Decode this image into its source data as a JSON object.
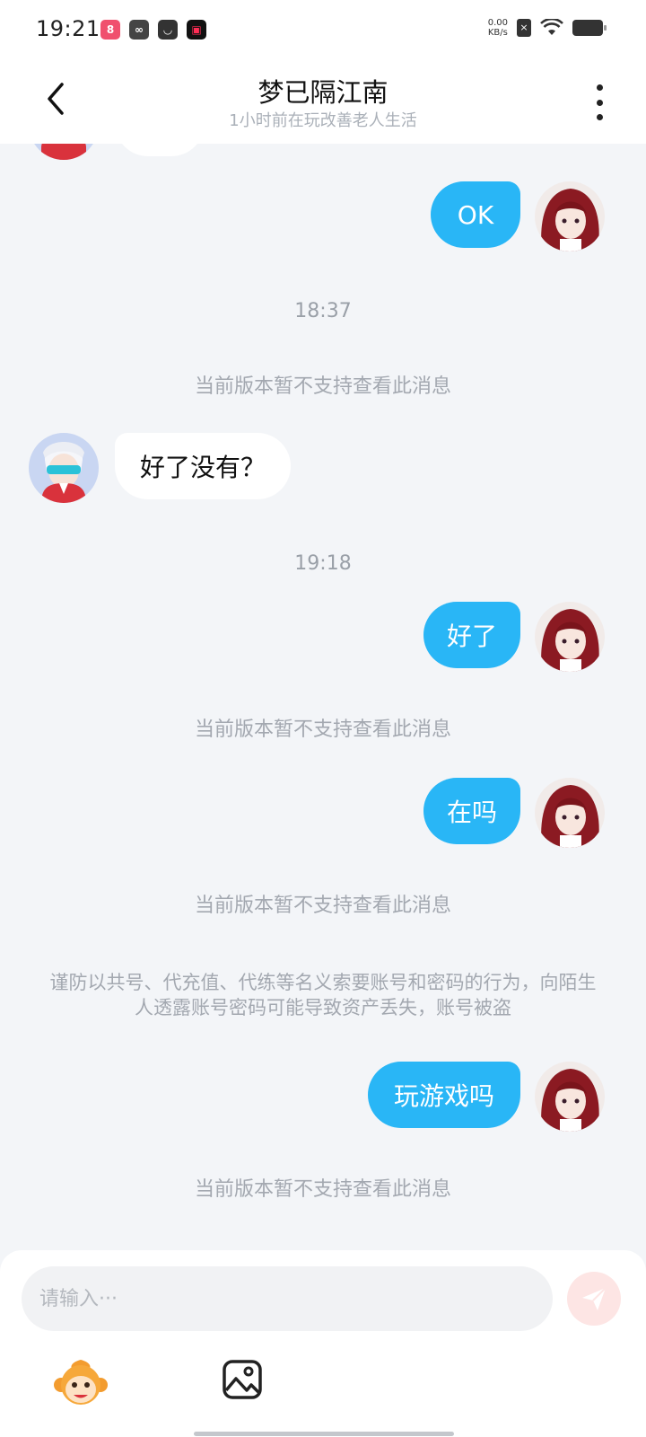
{
  "status_bar": {
    "time": "19:21",
    "net_speed_value": "0.00",
    "net_speed_unit": "KB/s"
  },
  "header": {
    "title": "梦已隔江南",
    "subtitle": "1小时前在玩改善老人生活"
  },
  "messages": {
    "m1": "OK",
    "t1": "18:37",
    "s1": "当前版本暂不支持查看此消息",
    "m2": "好了没有？",
    "t2": "19:18",
    "m3": "好了",
    "s2": "当前版本暂不支持查看此消息",
    "m4": "在吗",
    "s3": "当前版本暂不支持查看此消息",
    "warning": "谨防以共号、代充值、代练等名义索要账号和密码的行为，向陌生人透露账号密码可能导致资产丢失，账号被盗",
    "m5": "玩游戏吗",
    "s4": "当前版本暂不支持查看此消息"
  },
  "input": {
    "placeholder": "请输入···"
  },
  "icons": {
    "back": "chevron-left-icon",
    "more": "more-vertical-icon",
    "send": "send-icon",
    "emoji": "monkey-emoji-icon",
    "image": "image-icon"
  },
  "colors": {
    "outgoing_bubble": "#29b6f6",
    "incoming_bubble": "#ffffff",
    "send_button_disabled": "#fde5e4"
  }
}
